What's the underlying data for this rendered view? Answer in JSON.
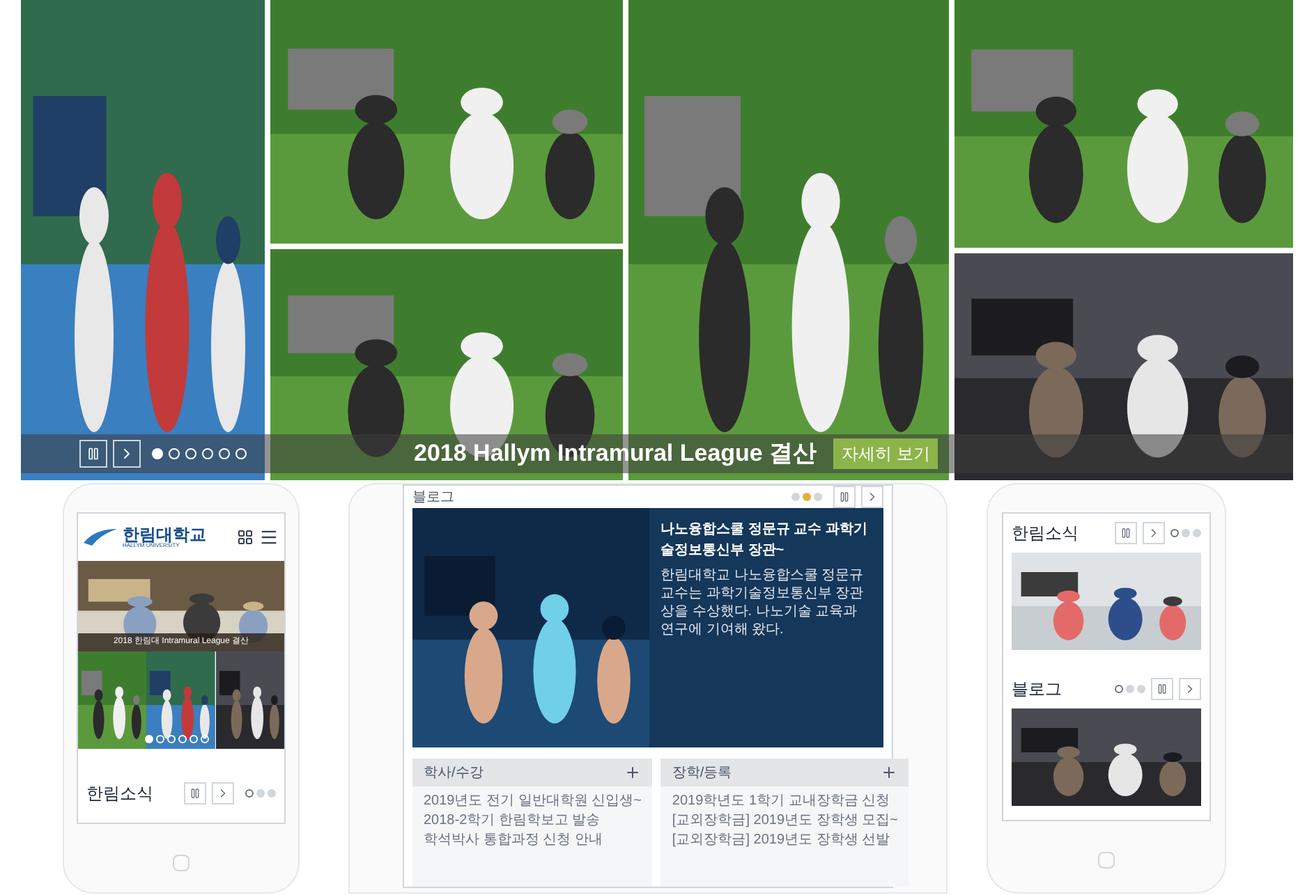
{
  "slider": {
    "caption": "2018 Hallym Intramural League 결산",
    "more_button": "자세히 보기",
    "dots": [
      {
        "selected": true
      },
      {
        "selected": false
      },
      {
        "selected": false
      },
      {
        "selected": false
      },
      {
        "selected": false
      },
      {
        "selected": false
      }
    ]
  },
  "phone_left": {
    "logo": "한림대학교",
    "logo_sub": "HALLYM UNIVERSITY",
    "banner_caption": "2018 한림대 Intramural League 결산",
    "banner_dots": [
      {
        "selected": true
      },
      {
        "selected": false
      },
      {
        "selected": false
      },
      {
        "selected": false
      },
      {
        "selected": false
      },
      {
        "selected": false
      }
    ],
    "news_title": "한림소식",
    "news_dots": [
      {
        "selected": true
      },
      {
        "selected": false
      },
      {
        "selected": false
      }
    ]
  },
  "tablet": {
    "section_title": "블로그",
    "dots": [
      {
        "selected": false
      },
      {
        "selected": true
      },
      {
        "selected": false
      }
    ],
    "post_title": "나노융합스쿨 정문규 교수 과학기술정보통신부 장관~",
    "post_body": "한림대학교 나노융합스쿨 정문규 교수는 과학기술정보통신부 장관상을 수상했다. 나노기술 교육과 연구에 기여해 왔다.",
    "boards": [
      {
        "title": "학사/수강",
        "items": [
          "2019년도 전기 일반대학원 신입생~",
          "2018-2학기 한림학보고 발송",
          "학석박사 통합과정 신청 안내"
        ]
      },
      {
        "title": "장학/등록",
        "items": [
          "2019학년도 1학기 교내장학금 신청",
          "[교외장학금] 2019년도 장학생 모집~",
          "[교외장학금] 2019년도 장학생 선발"
        ]
      }
    ]
  },
  "phone_right": {
    "sections": [
      {
        "title": "한림소식",
        "dots": [
          {
            "selected": true
          },
          {
            "selected": false
          },
          {
            "selected": false
          }
        ]
      },
      {
        "title": "블로그",
        "dots": [
          {
            "selected": true
          },
          {
            "selected": false
          },
          {
            "selected": false
          }
        ]
      }
    ]
  }
}
